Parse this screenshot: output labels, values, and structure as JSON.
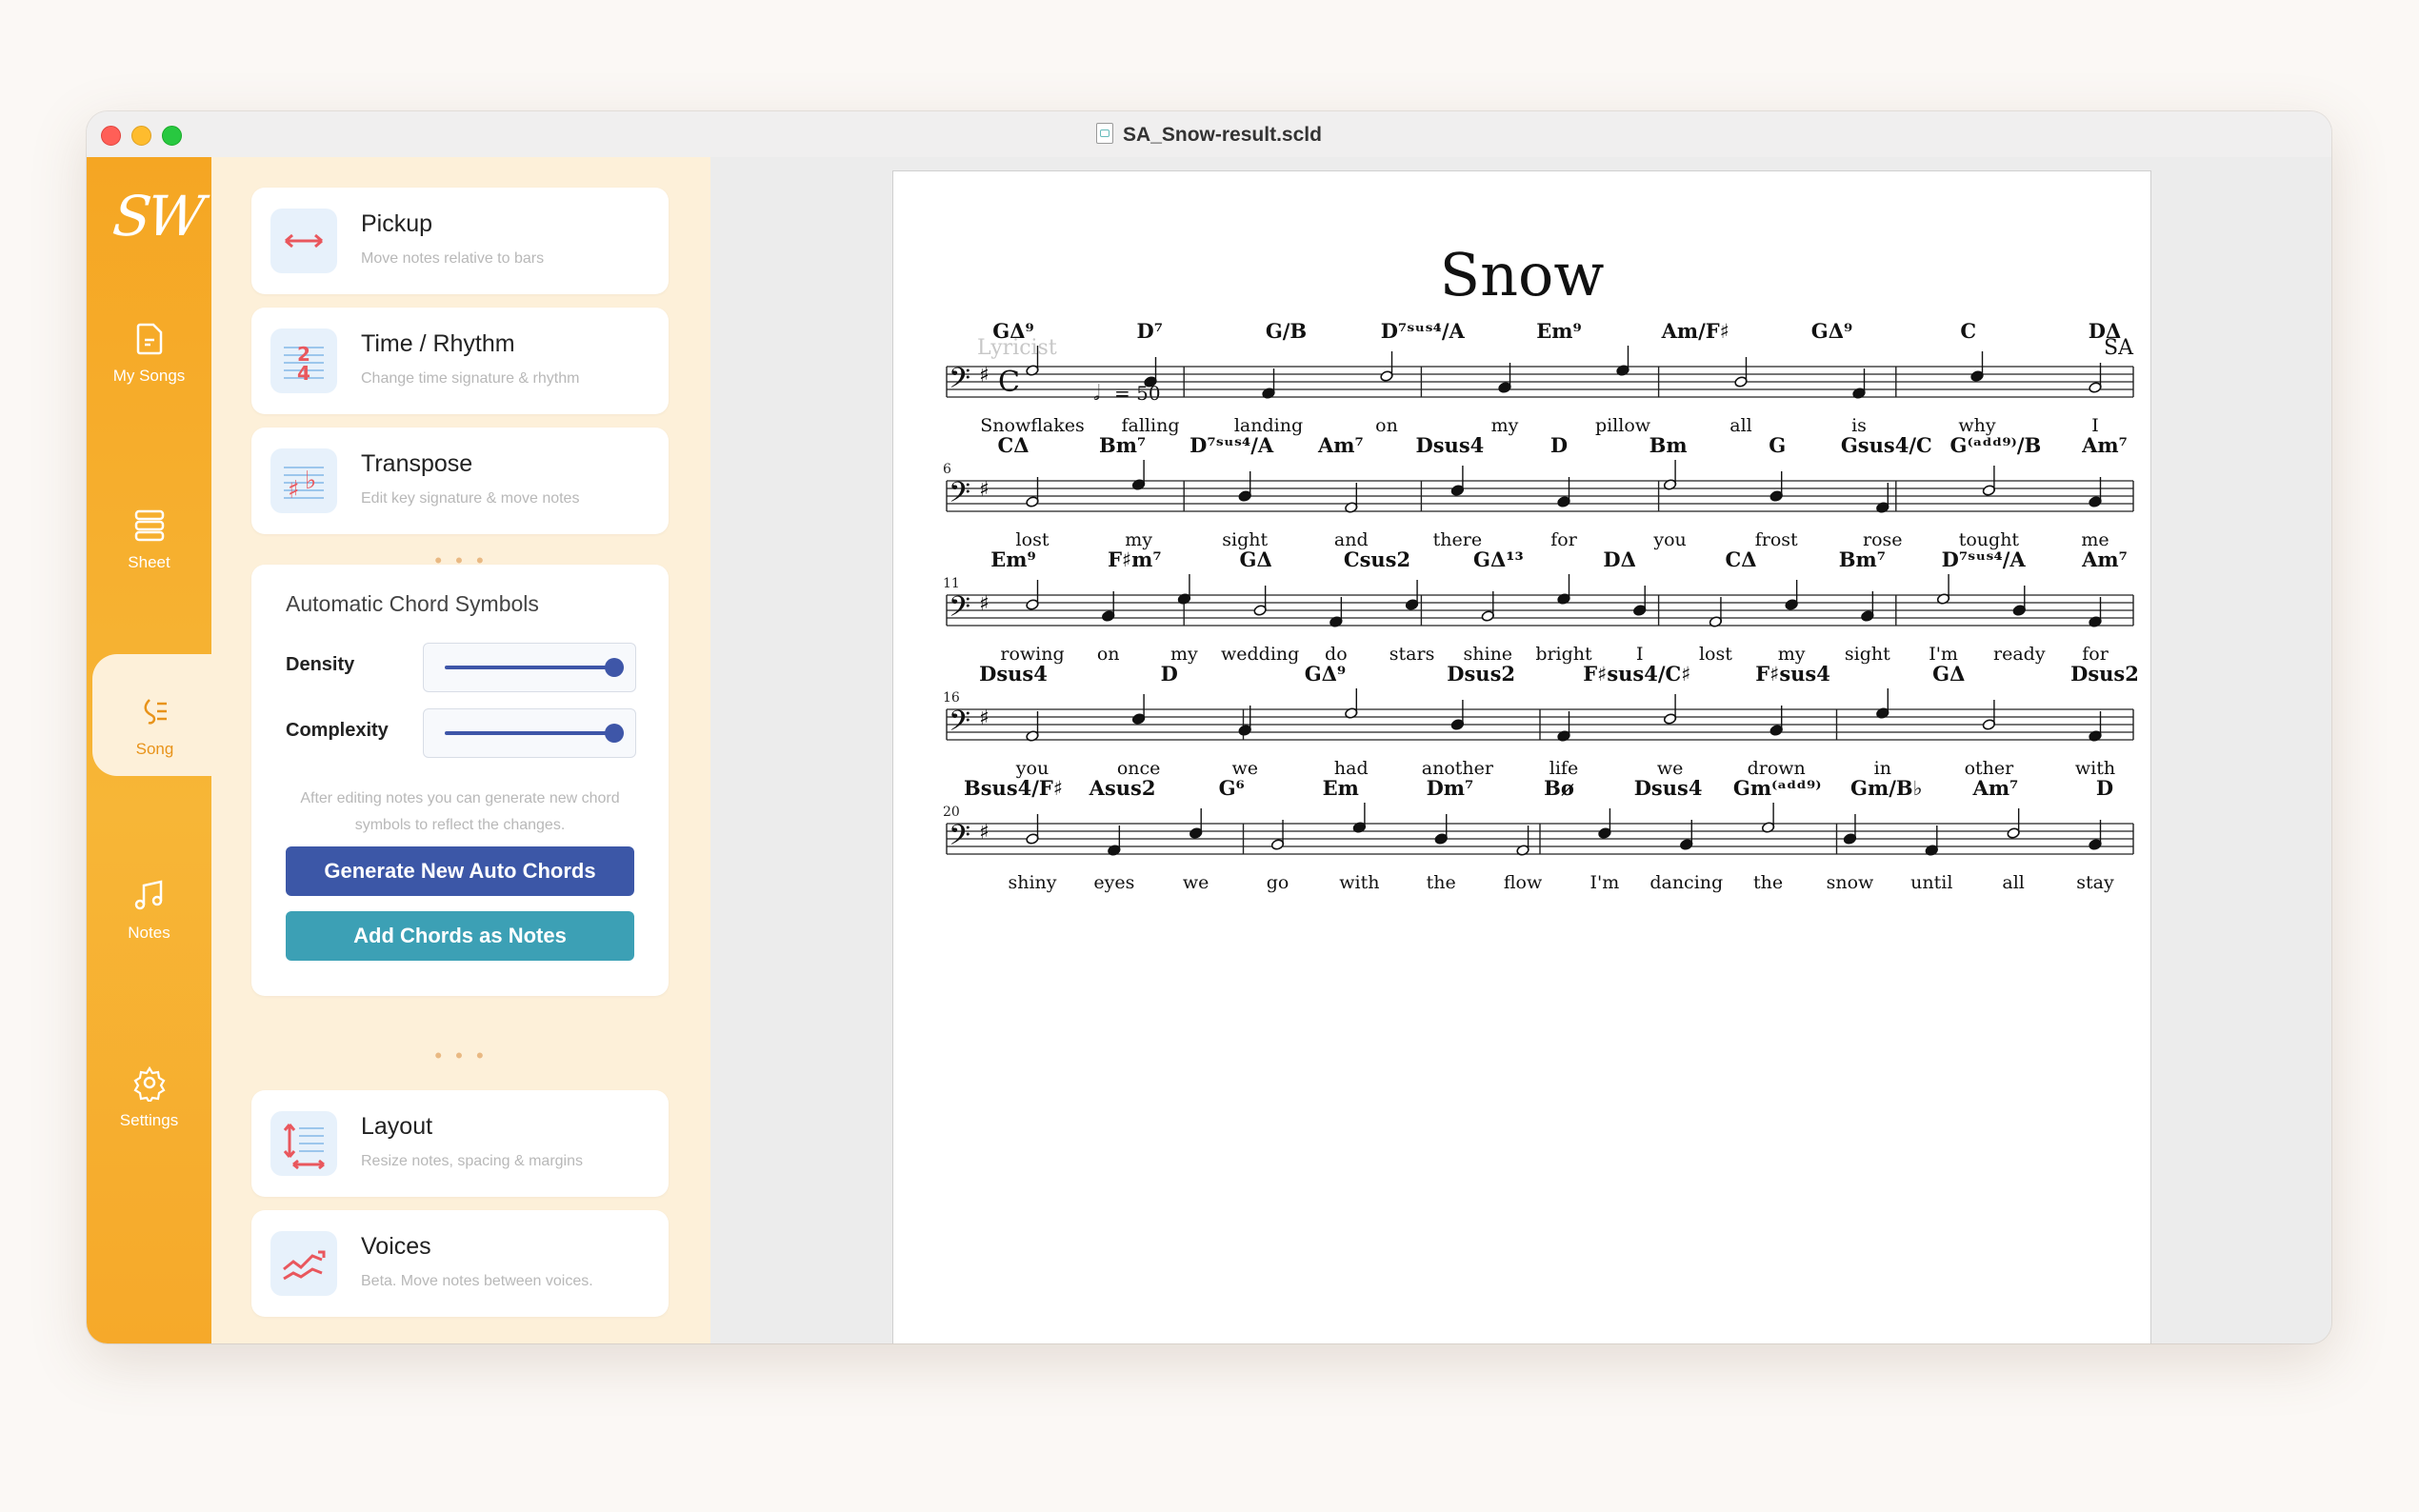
{
  "window": {
    "title": "SA_Snow-result.scld"
  },
  "nav": {
    "logo": "SW",
    "items": [
      {
        "label": "My Songs",
        "icon": "document-icon"
      },
      {
        "label": "Sheet",
        "icon": "sheet-icon"
      },
      {
        "label": "Song",
        "icon": "song-icon"
      },
      {
        "label": "Notes",
        "icon": "music-note-icon"
      },
      {
        "label": "Settings",
        "icon": "gear-icon"
      }
    ],
    "active": "Song"
  },
  "tools": [
    {
      "title": "Pickup",
      "subtitle": "Move notes relative to bars",
      "icon": "pickup-arrows-icon"
    },
    {
      "title": "Time / Rhythm",
      "subtitle": "Change time signature & rhythm",
      "icon": "time-signature-icon"
    },
    {
      "title": "Transpose",
      "subtitle": "Edit key signature & move notes",
      "icon": "transpose-icon"
    },
    {
      "title": "Layout",
      "subtitle": "Resize notes, spacing & margins",
      "icon": "layout-icon"
    },
    {
      "title": "Voices",
      "subtitle": "Beta. Move notes between voices.",
      "icon": "voices-icon"
    }
  ],
  "separator": "• • •",
  "chord_panel": {
    "title": "Automatic Chord Symbols",
    "density_label": "Density",
    "density_value": 1.0,
    "complexity_label": "Complexity",
    "complexity_value": 1.0,
    "note": "After editing notes you can generate new chord symbols to reflect the changes.",
    "generate_label": "Generate New Auto Chords",
    "add_label": "Add Chords as Notes"
  },
  "score": {
    "title": "Snow",
    "lyricist": "Lyricist",
    "composer": "SA",
    "tempo": "= 50",
    "systems": [
      {
        "measure_number": "",
        "chords": [
          "GΔ⁹",
          "D⁷",
          "G/B",
          "D⁷ˢᵘˢ⁴/A",
          "Em⁹",
          "Am/F♯",
          "GΔ⁹",
          "C",
          "DΔ"
        ],
        "lyrics": [
          "Snowflakes",
          "falling",
          "landing",
          "on",
          "my",
          "pillow",
          "all",
          "is",
          "why",
          "I"
        ]
      },
      {
        "measure_number": "6",
        "chords": [
          "CΔ",
          "Bm⁷",
          "D⁷ˢᵘˢ⁴/A",
          "Am⁷",
          "Dsus4",
          "D",
          "Bm",
          "G",
          "Gsus4/C",
          "G⁽ᵃᵈᵈ⁹⁾/B",
          "Am⁷"
        ],
        "lyrics": [
          "lost",
          "my",
          "sight",
          "and",
          "there",
          "for",
          "you",
          "frost",
          "rose",
          "tought",
          "me"
        ]
      },
      {
        "measure_number": "11",
        "chords": [
          "Em⁹",
          "F♯m⁷",
          "GΔ",
          "Csus2",
          "GΔ¹³",
          "DΔ",
          "CΔ",
          "Bm⁷",
          "D⁷ˢᵘˢ⁴/A",
          "Am⁷"
        ],
        "lyrics": [
          "rowing",
          "on",
          "my",
          "wedding",
          "do",
          "stars",
          "shine",
          "bright",
          "I",
          "lost",
          "my",
          "sight",
          "I'm",
          "ready",
          "for"
        ]
      },
      {
        "measure_number": "16",
        "chords": [
          "Dsus4",
          "D",
          "GΔ⁹",
          "Dsus2",
          "F♯sus4/C♯",
          "F♯sus4",
          "GΔ",
          "Dsus2"
        ],
        "lyrics": [
          "you",
          "once",
          "we",
          "had",
          "another",
          "life",
          "we",
          "drown",
          "in",
          "other",
          "with"
        ]
      },
      {
        "measure_number": "20",
        "chords": [
          "Bsus4/F♯",
          "Asus2",
          "G⁶",
          "Em",
          "Dm⁷",
          "Bø",
          "Dsus4",
          "Gm⁽ᵃᵈᵈ⁹⁾",
          "Gm/B♭",
          "Am⁷",
          "D"
        ],
        "lyrics": [
          "shiny",
          "eyes",
          "we",
          "go",
          "with",
          "the",
          "flow",
          "I'm",
          "dancing",
          "the",
          "snow",
          "until",
          "all",
          "stay"
        ]
      }
    ]
  }
}
